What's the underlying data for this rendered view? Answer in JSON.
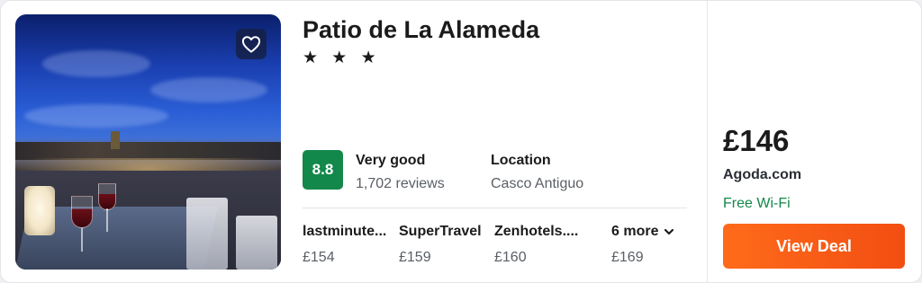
{
  "hotel": {
    "name": "Patio de La Alameda",
    "stars": "★ ★ ★",
    "star_rating": 3
  },
  "rating": {
    "score": "8.8",
    "label": "Very good",
    "reviews": "1,702 reviews",
    "badge_color": "#13884b"
  },
  "location": {
    "label": "Location",
    "value": "Casco Antiguo"
  },
  "providers": [
    {
      "name": "lastminute...",
      "price": "£154"
    },
    {
      "name": "SuperTravel",
      "price": "£159"
    },
    {
      "name": "Zenhotels....",
      "price": "£160"
    }
  ],
  "more": {
    "label": "6 more",
    "price": "£169"
  },
  "deal": {
    "price": "£146",
    "site": "Agoda.com",
    "perk": "Free Wi-Fi",
    "button_label": "View Deal",
    "button_color": "#f24e12",
    "perk_color": "#13884b"
  },
  "icons": {
    "favorite": "heart-outline-icon",
    "expand": "chevron-down-icon"
  }
}
